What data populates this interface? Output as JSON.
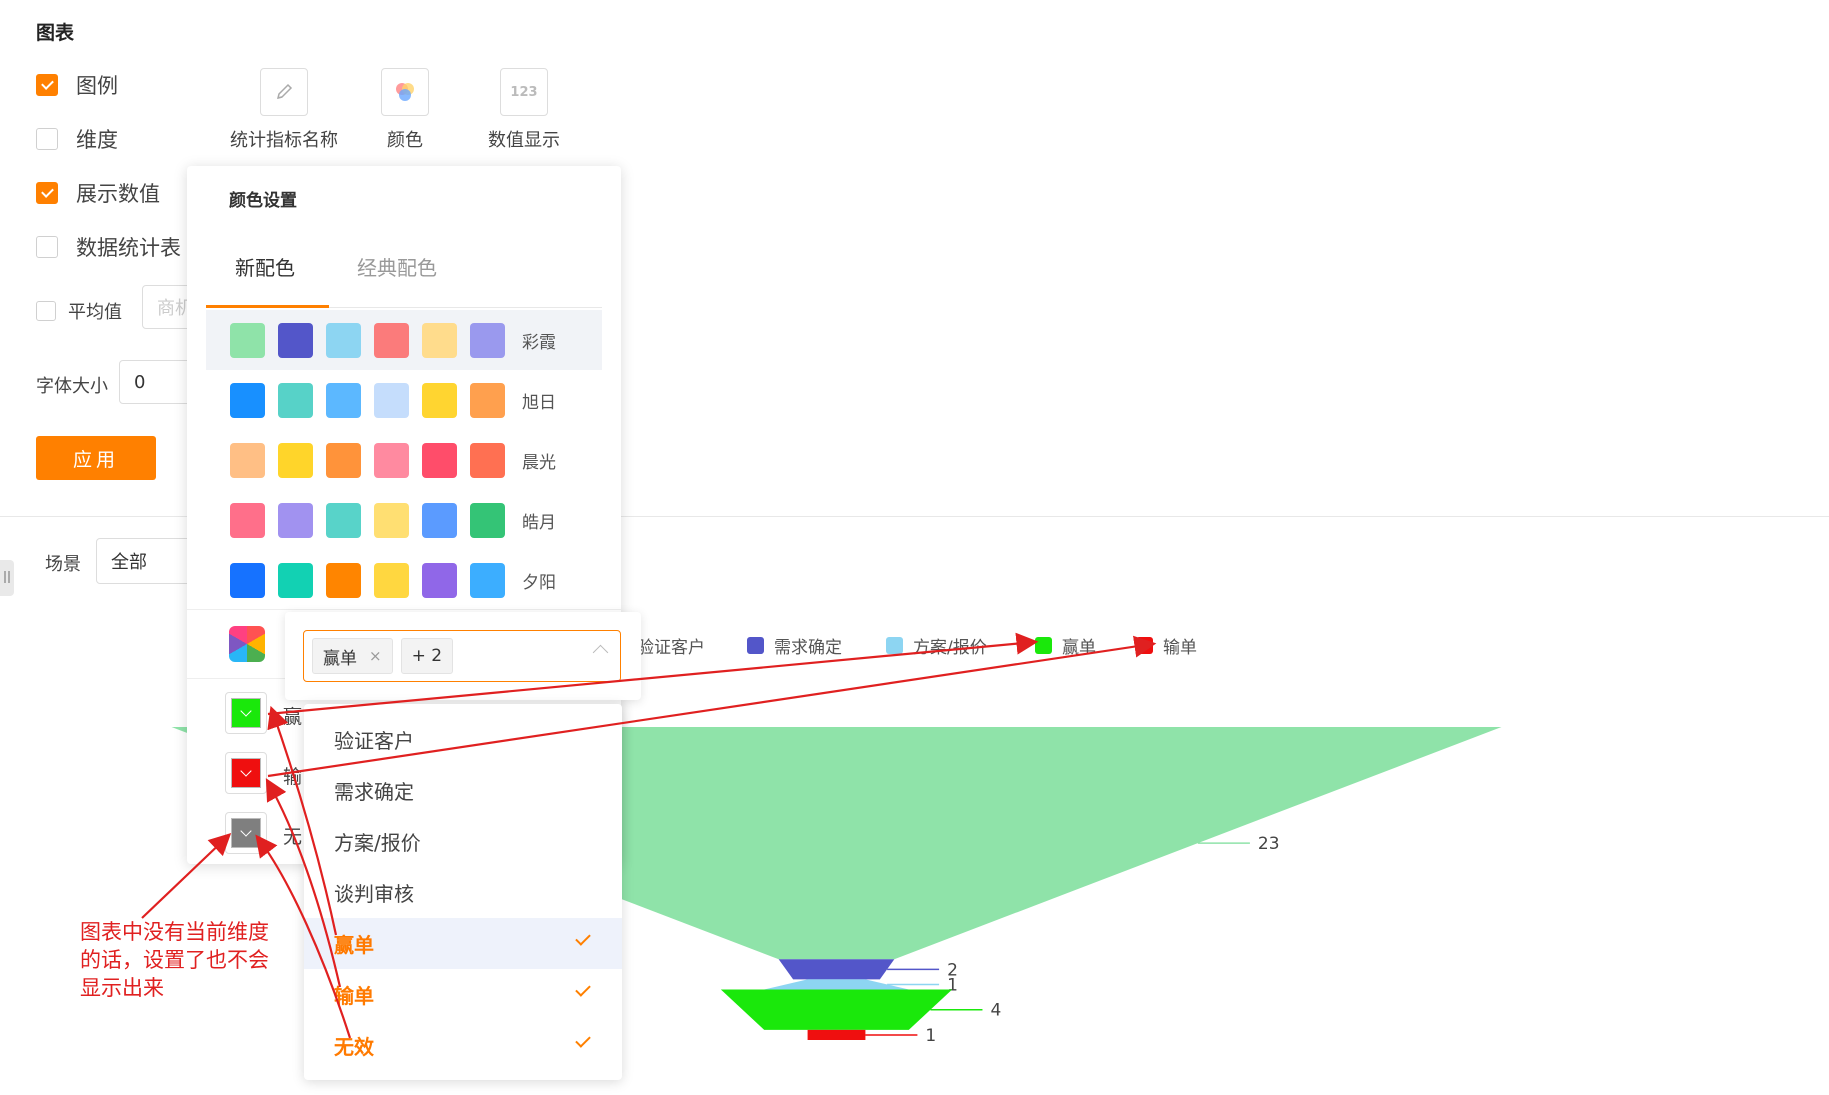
{
  "section_title": "图表",
  "options": [
    {
      "label": "图例",
      "checked": true
    },
    {
      "label": "维度",
      "checked": false
    },
    {
      "label": "展示数值",
      "checked": true
    },
    {
      "label": "数据统计表",
      "checked": false
    }
  ],
  "average": {
    "label": "平均值",
    "checked": false,
    "placeholder": "商机"
  },
  "font_size": {
    "label": "字体大小",
    "value": "0"
  },
  "apply_label": "应用",
  "tools": [
    {
      "label": "统计指标名称",
      "icon": "pencil-icon"
    },
    {
      "label": "颜色",
      "icon": "color-circles-icon"
    },
    {
      "label": "数值显示",
      "icon": "number-123-icon",
      "icon_text": "123"
    }
  ],
  "scene": {
    "label": "场景",
    "value": "全部"
  },
  "color_panel": {
    "title": "颜色设置",
    "tabs": [
      "新配色",
      "经典配色"
    ],
    "active_tab": "新配色",
    "schemes": [
      {
        "name": "彩霞",
        "colors": [
          "#8fe3a9",
          "#5356c9",
          "#8dd5f2",
          "#fb7b7b",
          "#ffdc8c",
          "#9a99ee"
        ],
        "selected": true
      },
      {
        "name": "旭日",
        "colors": [
          "#1890ff",
          "#57d2c8",
          "#5cb8ff",
          "#c5ddfc",
          "#ffd530",
          "#ffa04e"
        ],
        "selected": false
      },
      {
        "name": "晨光",
        "colors": [
          "#ffbf85",
          "#ffd52a",
          "#ff933a",
          "#ff8aa0",
          "#ff4d6a",
          "#ff7052"
        ],
        "selected": false
      },
      {
        "name": "皓月",
        "colors": [
          "#ff6f8a",
          "#a192f0",
          "#58d3c9",
          "#ffdf72",
          "#5b9bff",
          "#34c476"
        ],
        "selected": false
      },
      {
        "name": "夕阳",
        "colors": [
          "#1672ff",
          "#12d1b3",
          "#ff8500",
          "#ffd740",
          "#9067e8",
          "#3caeff"
        ],
        "selected": false
      }
    ],
    "custom_colors": [
      {
        "label": "赢",
        "color": "#1ae80b"
      },
      {
        "label": "输",
        "color": "#ef0f0f"
      },
      {
        "label": "无",
        "color": "#7f7f7f"
      }
    ]
  },
  "multiselect": {
    "tags": [
      "赢单"
    ],
    "more": "+ 2",
    "remove_icon": "×",
    "options": [
      {
        "label": "验证客户",
        "selected": false
      },
      {
        "label": "需求确定",
        "selected": false
      },
      {
        "label": "方案/报价",
        "selected": false
      },
      {
        "label": "谈判审核",
        "selected": false
      },
      {
        "label": "赢单",
        "selected": true
      },
      {
        "label": "输单",
        "selected": true
      },
      {
        "label": "无效",
        "selected": true
      }
    ]
  },
  "legend": [
    {
      "label": "验证客户",
      "color": "#8fe3a9"
    },
    {
      "label": "需求确定",
      "color": "#5356c9"
    },
    {
      "label": "方案/报价",
      "color": "#8dd5f2"
    },
    {
      "label": "赢单",
      "color": "#1ae80b"
    },
    {
      "label": "输单",
      "color": "#ef0f0f"
    }
  ],
  "chart_data": {
    "type": "funnel",
    "categories": [
      "验证客户",
      "需求确定",
      "方案/报价",
      "赢单",
      "输单"
    ],
    "values": [
      23,
      2,
      1,
      4,
      1
    ],
    "colors": [
      "#8fe3a9",
      "#5356c9",
      "#8dd5f2",
      "#1ae80b",
      "#ef0f0f"
    ],
    "value_labels": [
      "23",
      "2",
      "1",
      "4",
      "1"
    ],
    "legend_position": "top"
  },
  "annotation": [
    "图表中没有当前维度",
    "的话，设置了也不会",
    "显示出来"
  ]
}
